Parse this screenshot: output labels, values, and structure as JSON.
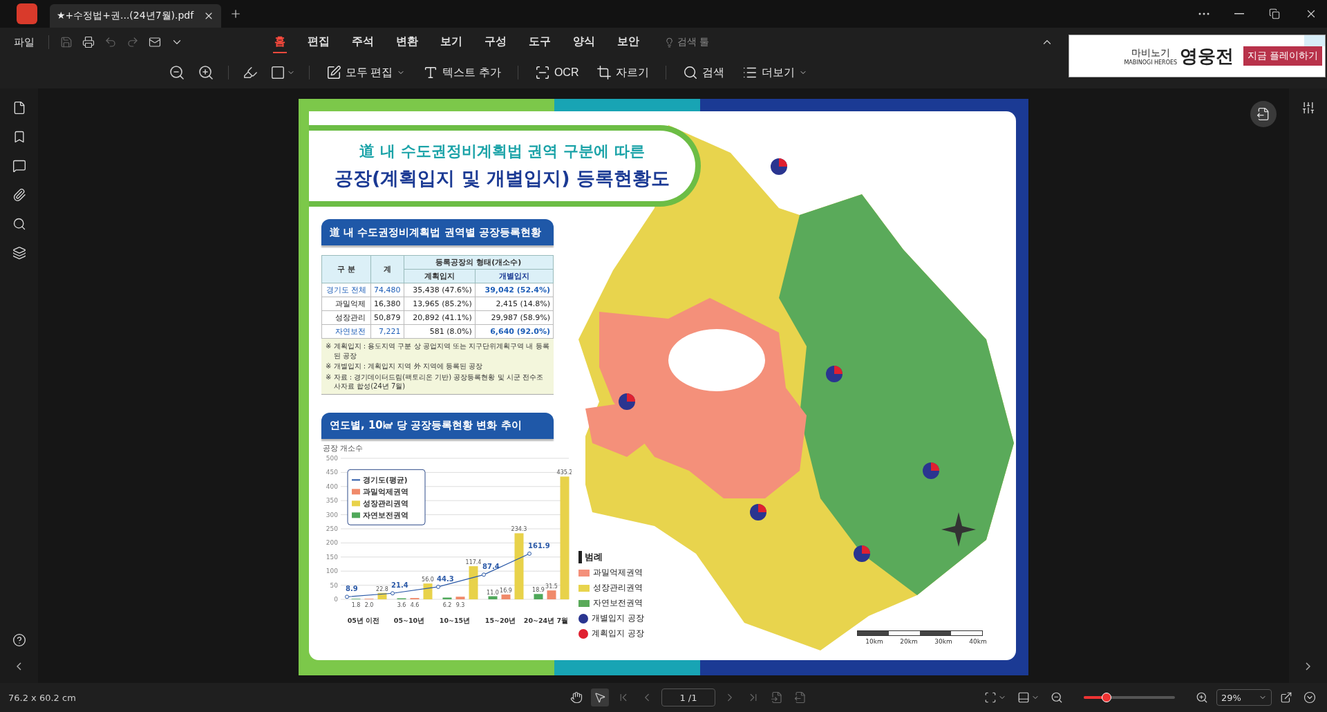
{
  "tab": {
    "title": "★+수정법+권...(24년7월).pdf"
  },
  "menu_bar": {
    "file": "파일",
    "menus": [
      {
        "label": "홈",
        "selected": true
      },
      {
        "label": "편집",
        "selected": false
      },
      {
        "label": "주석",
        "selected": false
      },
      {
        "label": "변환",
        "selected": false
      },
      {
        "label": "보기",
        "selected": false
      },
      {
        "label": "구성",
        "selected": false
      },
      {
        "label": "도구",
        "selected": false
      },
      {
        "label": "양식",
        "selected": false
      },
      {
        "label": "보안",
        "selected": false
      }
    ],
    "search_tool": "검색 툴"
  },
  "toolbar": [
    "모두 편집",
    "텍스트 추가",
    "OCR",
    "자르기",
    "검색",
    "더보기"
  ],
  "ad": {
    "brand_small": "마비노기",
    "brand_sub": "MABINOGI HEROES",
    "brand_big": "영웅전",
    "cta": "지금 플레이하기"
  },
  "document": {
    "title_line1": "道 내 수도권정비계획법 권역 구분에 따른",
    "title_line2": "공장(계획입지 및 개별입지) 등록현황도",
    "table_section": {
      "heading": "道 내 수도권정비계획법 권역별 공장등록현황",
      "columns": {
        "category": "구  분",
        "total": "계",
        "group": "등록공장의 형태(개소수)",
        "planned": "계획입지",
        "individual": "개별입지"
      },
      "rows": [
        {
          "kind": "total",
          "highlight": true,
          "label": "경기도 전체",
          "total": "74,480",
          "planned": "35,438 (47.6%)",
          "individual": "39,042 (52.4%)"
        },
        {
          "kind": "sub",
          "highlight": false,
          "label": "과밀억제",
          "total": "16,380",
          "planned": "13,965 (85.2%)",
          "individual": "2,415 (14.8%)"
        },
        {
          "kind": "sub",
          "highlight": false,
          "label": "성장관리",
          "total": "50,879",
          "planned": "20,892 (41.1%)",
          "individual": "29,987 (58.9%)"
        },
        {
          "kind": "sub",
          "highlight": true,
          "label": "자연보전",
          "total": "7,221",
          "planned": "581 (8.0%)",
          "individual": "6,640 (92.0%)"
        }
      ],
      "notes": [
        "※ 계획입지 : 용도지역 구분 상 공업지역 또는 지구단위계획구역 내 등록된 공장",
        "※ 개별입지 : 계획입지 지역 外 지역에 등록된 공장",
        "※ 자료 : 경기데이터드림(팩토리온 기반) 공장등록현황 및 시군 전수조사자료 합성(24년 7월)"
      ]
    },
    "chart_section": {
      "heading": "연도별, 10㎢ 당 공장등록현황 변화 추이",
      "chart_data": {
        "type": "bar",
        "ylabel": "공장 개소수",
        "categories": [
          "05년 이전",
          "05~10년",
          "10~15년",
          "15~20년",
          "20~24년 7월"
        ],
        "ylim": [
          0,
          500
        ],
        "yticks": [
          0,
          50,
          100,
          150,
          200,
          250,
          300,
          350,
          400,
          450,
          500
        ],
        "stacked": false,
        "grid": true,
        "legend": "upper left",
        "series": [
          {
            "name": "경기도(평균)",
            "type": "line",
            "marker": "circle",
            "color": "#2c5aa8",
            "values": [
              8.9,
              21.4,
              44.3,
              87.4,
              161.9
            ]
          },
          {
            "name": "과밀억제권역",
            "type": "bar",
            "color": "#f08a6a",
            "values": [
              2.0,
              4.6,
              9.3,
              16.9,
              31.5
            ]
          },
          {
            "name": "성장관리권역",
            "type": "bar",
            "color": "#e8d24a",
            "values": [
              22.8,
              56.0,
              117.4,
              234.3,
              435.2
            ]
          },
          {
            "name": "자연보전권역",
            "type": "bar",
            "color": "#4fa85a",
            "values": [
              1.8,
              3.6,
              6.2,
              11.0,
              18.9
            ]
          }
        ],
        "value_labels": [
          [
            "8.9",
            "21.4",
            "44.3",
            "87.4",
            "161.9"
          ],
          [
            "2.0",
            "4.6",
            "9.3",
            "16.9",
            "31.5"
          ],
          [
            "22.8",
            "56.0",
            "117.4",
            "234.3",
            "435.2"
          ],
          [
            "1.8",
            "3.6",
            "6.2",
            "11.0",
            "18.9"
          ]
        ]
      }
    },
    "map": {
      "kind": "picture"
    },
    "legend": {
      "title": "범례",
      "items": [
        {
          "kind": "area",
          "label": "과밀억제권역",
          "color": "#f4907a"
        },
        {
          "kind": "area",
          "label": "성장관리권역",
          "color": "#e8d44d"
        },
        {
          "kind": "area",
          "label": "자연보전권역",
          "color": "#5aaa5a"
        },
        {
          "kind": "point",
          "label": "개별입지 공장",
          "color": "#2a3590"
        },
        {
          "kind": "point",
          "label": "계획입지 공장",
          "color": "#e02030"
        }
      ]
    },
    "scale": [
      "10km",
      "20km",
      "30km",
      "40km"
    ]
  },
  "status_bar": {
    "size": "76.2 x 60.2 cm",
    "page": "1 /1",
    "zoom_slider": {
      "level": 0.25
    },
    "zoom": "29%"
  }
}
